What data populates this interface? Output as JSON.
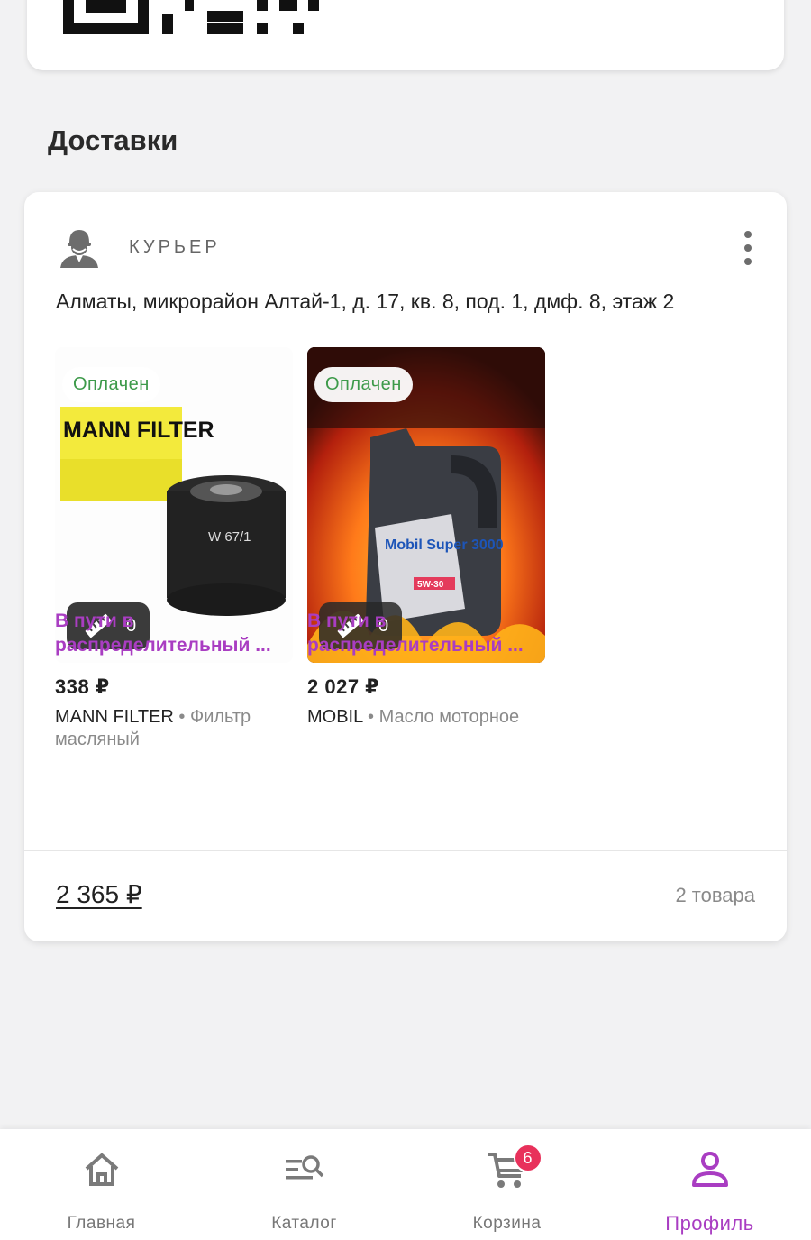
{
  "section_title": "Доставки",
  "delivery": {
    "method_label": "КУРЬЕР",
    "address": "Алматы, микрорайон Алтай-1, д. 17, кв. 8, под. 1, дмф. 8, этаж 2",
    "items": [
      {
        "badge": "Оплачен",
        "size_count": "0",
        "price": "338 ₽",
        "brand": "MANN FILTER",
        "separator": " • ",
        "type": "Фильтр масляный",
        "status_line1": "В пути в",
        "status_line2": "распределительный ...",
        "image_text_brand": "MANN FILTER",
        "image_text_model": "W 67/1"
      },
      {
        "badge": "Оплачен",
        "size_count": "0",
        "price": "2 027 ₽",
        "brand": "MOBIL",
        "separator": " • ",
        "type": "Масло моторное",
        "status_line1": "В пути в",
        "status_line2": "распределительный ...",
        "image_text_brand": "Mobil Super 3000",
        "image_text_grade": "5W-30"
      }
    ],
    "total": "2 365 ₽",
    "count": "2 товара"
  },
  "nav": {
    "home": "Главная",
    "catalog": "Каталог",
    "cart": "Корзина",
    "cart_badge": "6",
    "profile": "Профиль"
  },
  "colors": {
    "accent": "#a93dc2",
    "paid_green": "#3d9a4a",
    "badge_red": "#e8315b"
  }
}
